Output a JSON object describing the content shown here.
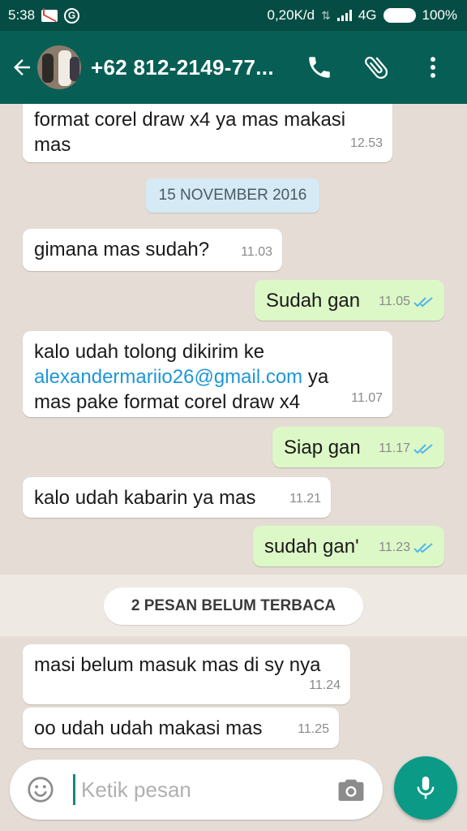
{
  "status_bar": {
    "time": "5:38",
    "speed": "0,20K/d",
    "network": "4G",
    "battery": "100%"
  },
  "header": {
    "contact_name": "+62 812-2149-77...",
    "icons": [
      "back-arrow-icon",
      "phone-icon",
      "attachment-icon",
      "more-vert-icon"
    ]
  },
  "chat": {
    "date_divider": "15 NOVEMBER 2016",
    "unread_divider": "2 PESAN BELUM TERBACA",
    "messages": [
      {
        "direction": "in",
        "text": "format corel draw x4 ya mas makasi\nmas",
        "time": "12.53"
      },
      {
        "direction": "in",
        "text": "gimana mas sudah?",
        "time": "11.03"
      },
      {
        "direction": "out",
        "text": "Sudah gan",
        "time": "11.05",
        "read": true
      },
      {
        "direction": "in",
        "text_before": "kalo udah tolong dikirim ke\n",
        "link": "alexandermariio26@gmail.com",
        "text_after": " ya\nmas pake format corel draw x4",
        "time": "11.07"
      },
      {
        "direction": "out",
        "text": "Siap gan",
        "time": "11.17",
        "read": true
      },
      {
        "direction": "in",
        "text": "kalo udah kabarin ya mas",
        "time": "11.21"
      },
      {
        "direction": "out",
        "text": "sudah gan'",
        "time": "11.23",
        "read": true
      },
      {
        "direction": "in",
        "text": "masi belum masuk mas di sy nya",
        "time": "11.24"
      },
      {
        "direction": "in",
        "text": "oo udah udah makasi mas",
        "time": "11.25"
      }
    ]
  },
  "composer": {
    "placeholder": "Ketik pesan",
    "value": ""
  },
  "colors": {
    "header": "#075e54",
    "status_bar": "#054d44",
    "chat_background": "#e5ddd5",
    "outgoing_bubble": "#dcf8c6",
    "incoming_bubble": "#ffffff",
    "accent": "#0a9a86",
    "link": "#1e96d6",
    "read_ticks": "#4fb6ec"
  }
}
